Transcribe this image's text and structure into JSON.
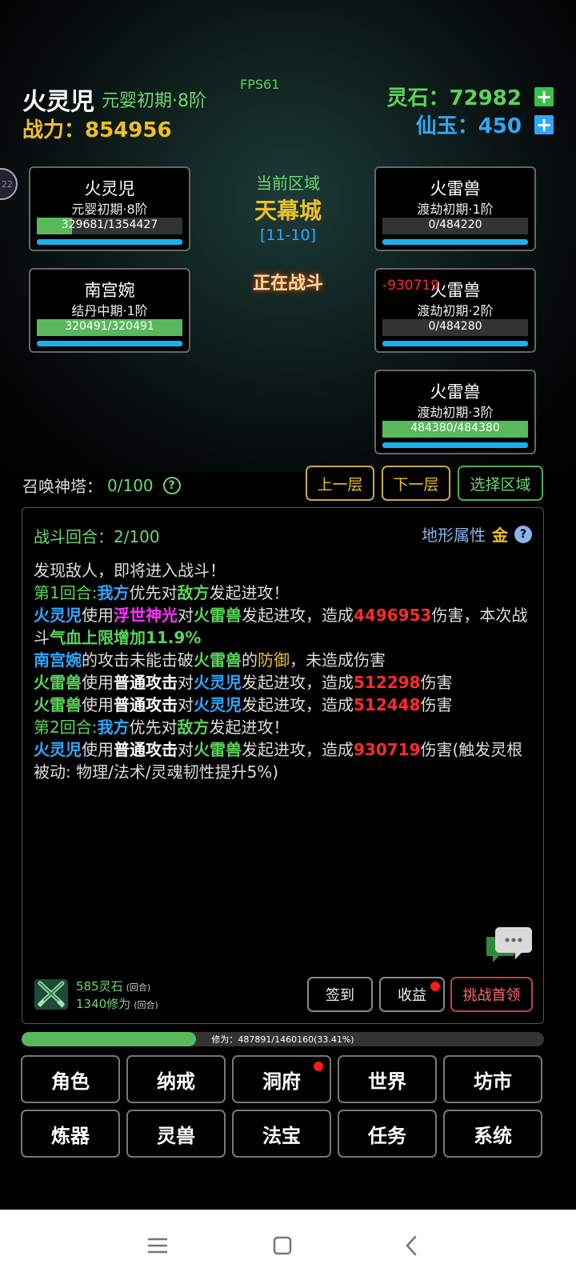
{
  "header": {
    "player_name": "火灵児",
    "player_realm": "元婴初期·8阶",
    "fps": "FPS61",
    "power": "战力：854956",
    "spirit_stone": "灵石：72982",
    "immortal_jade": "仙玉：450",
    "side_bubble": "22"
  },
  "zone": {
    "label": "当前区域",
    "name": "天幕城",
    "code": "[11-10]",
    "battle_state": "正在战斗"
  },
  "allies": [
    {
      "name": "火灵児",
      "realm": "元婴初期·8阶",
      "hp_text": "329681/1354427",
      "hp_fraction": 0.2434
    },
    {
      "name": "南宫婉",
      "realm": "结丹中期·1阶",
      "hp_text": "320491/320491",
      "hp_fraction": 1.0
    }
  ],
  "enemies": [
    {
      "name": "火雷兽",
      "realm": "渡劫初期·1阶",
      "hp_text": "0/484220",
      "hp_fraction": 0.0,
      "damage_popup": ""
    },
    {
      "name": "火雷兽",
      "realm": "渡劫初期·2阶",
      "hp_text": "0/484280",
      "hp_fraction": 0.0,
      "damage_popup": "-930719"
    },
    {
      "name": "火雷兽",
      "realm": "渡劫初期·3阶",
      "hp_text": "484380/484380",
      "hp_fraction": 1.0,
      "damage_popup": ""
    }
  ],
  "tower": {
    "label": "召唤神塔：",
    "value": "0/100",
    "help": "?"
  },
  "nav_buttons": {
    "prev": "上一层",
    "next": "下一层",
    "select_zone": "选择区域"
  },
  "battle_panel": {
    "round": "战斗回合：2/100",
    "terrain_label": "地形属性",
    "terrain_value": "金",
    "help": "?",
    "log": {
      "l1": "发现敌人，即将进入战斗！",
      "l2a": "第1回合:",
      "l2b": "我方",
      "l2c": "优先对",
      "l2d": "敌方",
      "l2e": "发起进攻！",
      "l3a": "火灵児",
      "l3b": "使用",
      "l3c": "浮世神光",
      "l3d": "对",
      "l3e": "火雷兽",
      "l3f": "发起进攻，造成",
      "l3g": "4496953",
      "l3h": "伤害，本次战斗",
      "l3i": "气血上限增加11.9%",
      "l4a": "南宫婉",
      "l4b": "的攻击未能击破",
      "l4c": "火雷兽",
      "l4d": "的",
      "l4e": "防御",
      "l4f": "，未造成伤害",
      "l5a": "火雷兽",
      "l5b": "使用",
      "l5c": "普通攻击",
      "l5d": "对",
      "l5e": "火灵児",
      "l5f": "发起进攻，造成",
      "l5g": "512298",
      "l5h": "伤害",
      "l6a": "火雷兽",
      "l6b": "使用",
      "l6c": "普通攻击",
      "l6d": "对",
      "l6e": "火灵児",
      "l6f": "发起进攻，造成",
      "l6g": "512448",
      "l6h": "伤害",
      "l7a": "第2回合:",
      "l7b": "我方",
      "l7c": "优先对",
      "l7d": "敌方",
      "l7e": "发起进攻！",
      "l8a": "火灵児",
      "l8b": "使用",
      "l8c": "普通攻击",
      "l8d": "对",
      "l8e": "火雷兽",
      "l8f": "发起进攻，造成",
      "l8g": "930719",
      "l8h": "伤害(触发灵根被动: 物理/法术/灵魂韧性提升5%)"
    },
    "reward_stone": "585灵石",
    "reward_stone_note": "(回合)",
    "reward_cultivation": "1340修为",
    "reward_cultivation_note": "(回合)",
    "btn_signin": "签到",
    "btn_income": "收益",
    "btn_boss": "挑战首领"
  },
  "xp": {
    "text": "修为：487891/1460160(33.41%)",
    "fraction": 0.3341
  },
  "menu": [
    "角色",
    "纳戒",
    "洞府",
    "世界",
    "坊市",
    "炼器",
    "灵兽",
    "法宝",
    "任务",
    "系统"
  ],
  "colors": {
    "green": "#5ad45a",
    "gold": "#f0c020",
    "blue": "#2ea8ff",
    "red": "#ff2a2a",
    "magenta": "#ff33ff"
  },
  "icons": [
    "plus-icon",
    "help-icon",
    "chat-icon",
    "crossed-swords-icon",
    "menu-icon",
    "home-square-icon",
    "back-chevron-icon"
  ]
}
